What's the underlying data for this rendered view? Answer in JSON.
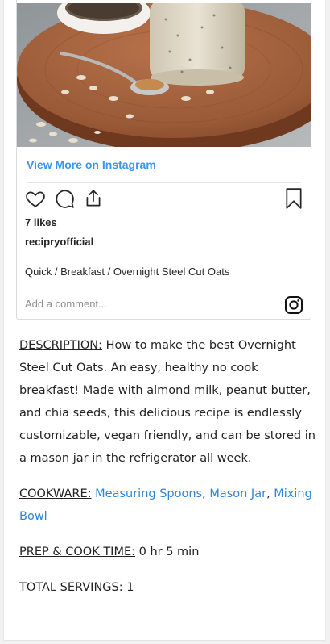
{
  "embed": {
    "view_more_label": "View More on Instagram",
    "likes": "7 likes",
    "account": "recipryofficial",
    "caption": "Quick / Breakfast / Overnight Steel Cut Oats",
    "comment_placeholder": "Add a comment..."
  },
  "recipe": {
    "description_label": "DESCRIPTION:",
    "description_text": "How to make the best Overnight Steel Cut Oats. An easy, healthy no cook breakfast! Made with almond milk, peanut butter, and chia seeds, this delicious recipe is endlessly customizable, vegan friendly, and can be stored in a mason jar in the refrigerator all week.",
    "cookware_label": "COOKWARE:",
    "cookware_links": [
      "Measuring Spoons",
      "Mason Jar",
      "Mixing Bowl"
    ],
    "cookware_sep": ", ",
    "prep_label": "PREP & COOK TIME:",
    "prep_value": "0 hr 5 min",
    "servings_label": "TOTAL SERVINGS:",
    "servings_value": "1"
  },
  "colors": {
    "instagram_link": "#3897f0",
    "cookware_link": "#2b86d9"
  }
}
